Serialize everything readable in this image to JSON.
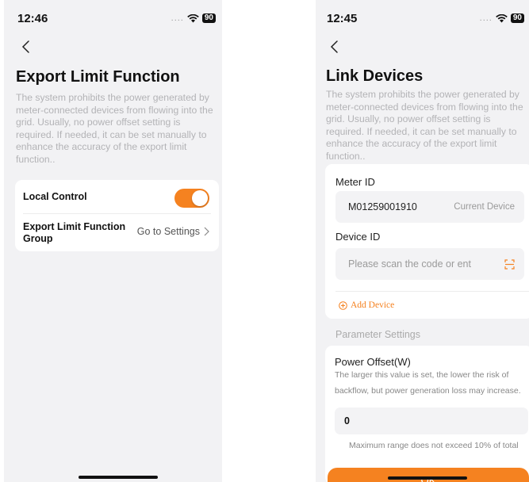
{
  "colors": {
    "accent": "#f58220",
    "background": "#f2f2f4"
  },
  "left": {
    "status": {
      "time": "12:46",
      "signal": "....",
      "battery": "90"
    },
    "title": "Export Limit Function",
    "description": "The system prohibits the power generated by meter-connected devices from flowing into the grid. Usually, no power offset setting is required. If needed, it can be set manually to enhance the accuracy of the export limit function..",
    "rows": {
      "local_control": {
        "label": "Local Control",
        "toggle_on": true
      },
      "export_group": {
        "label_line1": "Export Limit Function",
        "label_line2": "Group",
        "action": "Go to Settings"
      }
    }
  },
  "right": {
    "status": {
      "time": "12:45",
      "signal": "....",
      "battery": "90"
    },
    "title": "Link Devices",
    "description": "The system prohibits the power generated by meter-connected devices from flowing into the grid. Usually, no power offset setting is required. If needed, it can be set manually to enhance the accuracy of the export limit function..",
    "meter_id_label": "Meter ID",
    "meter_id_value": "M01259001910",
    "meter_tag": "Current Device",
    "device_id_label": "Device ID",
    "device_id_placeholder": "Please scan the code or ent",
    "add_device": "Add Device",
    "parameter_settings": "Parameter Settings",
    "power_offset_title": "Power Offset(W)",
    "power_offset_desc": "The larger this value is set, the lower the risk of backflow, but power generation loss may increase.",
    "power_offset_value": "0",
    "power_offset_hint": "Maximum range does not exceed 10% of total",
    "ok_button": "OK"
  }
}
